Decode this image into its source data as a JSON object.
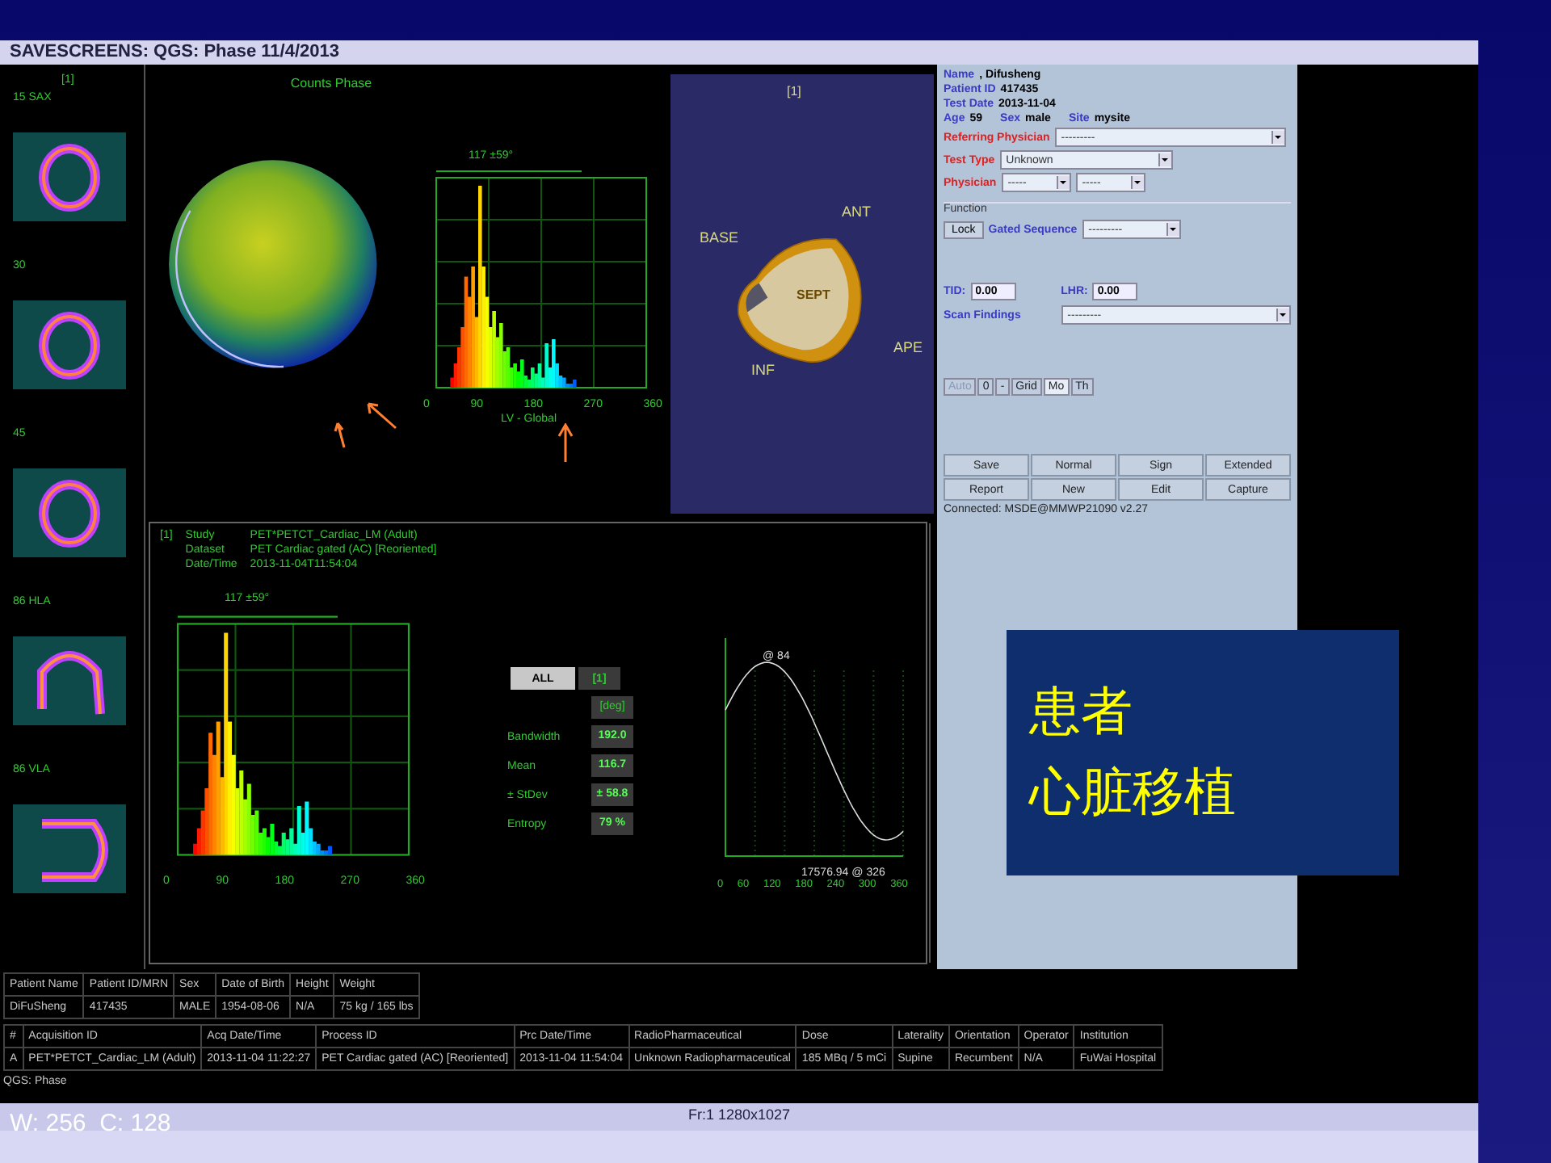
{
  "window": {
    "title": "SAVESCREENS: QGS: Phase 11/4/2013"
  },
  "slices": [
    {
      "label": "15 SAX",
      "kind": "sax"
    },
    {
      "label": "30",
      "kind": "sax"
    },
    {
      "label": "45",
      "kind": "sax"
    },
    {
      "label": "86 HLA",
      "kind": "hla"
    },
    {
      "label": "86 VLA",
      "kind": "vla"
    }
  ],
  "slices_index": "[1]",
  "polar_map": {
    "title": "Counts Phase"
  },
  "phase_histogram": {
    "range_label": "117 ±59°",
    "xticks": [
      "0",
      "90",
      "180",
      "270",
      "360"
    ],
    "xlabel": "LV - Global"
  },
  "model_3d": {
    "index": "[1]",
    "labels": [
      {
        "text": "BASE",
        "kind": "base"
      },
      {
        "text": "ANT",
        "kind": "ant"
      },
      {
        "text": "SEPT",
        "kind": "sept"
      },
      {
        "text": "INF",
        "kind": "inf"
      },
      {
        "text": "APE",
        "kind": "ape"
      }
    ]
  },
  "patient_panel": {
    "info": [
      {
        "label": "Name",
        "value": ", Difusheng"
      },
      {
        "label": "Patient ID",
        "value": "417435"
      },
      {
        "label": "Test Date",
        "value": "2013-11-04"
      }
    ],
    "info_row": [
      {
        "label": "Age",
        "value": "59"
      },
      {
        "label": "Sex",
        "value": "male"
      },
      {
        "label": "Site",
        "value": "mysite"
      }
    ],
    "referring_physician": {
      "label": "Referring Physician",
      "value": "---------"
    },
    "test_type": {
      "label": "Test Type",
      "value": "Unknown"
    },
    "physician": {
      "label": "Physician",
      "values": [
        "-----",
        "-----"
      ]
    },
    "function": {
      "legend": "Function",
      "lock": "Lock",
      "gated_label": "Gated Sequence",
      "gated_value": "---------"
    },
    "tid": {
      "label": "TID:",
      "value": "0.00"
    },
    "lhr": {
      "label": "LHR:",
      "value": "0.00"
    },
    "scan_findings": {
      "label": "Scan Findings",
      "value": "---------"
    },
    "toolbar": [
      {
        "label": "Auto",
        "selected": false,
        "disabled": true
      },
      {
        "label": "0",
        "selected": false,
        "disabled": false
      },
      {
        "label": "-",
        "selected": false,
        "disabled": false
      },
      {
        "label": "Grid",
        "selected": false,
        "disabled": false
      },
      {
        "label": "Mo",
        "selected": true,
        "disabled": false
      },
      {
        "label": "Th",
        "selected": false,
        "disabled": false
      }
    ],
    "buttons": [
      "Save",
      "Normal",
      "Sign",
      "Extended",
      "Report",
      "New",
      "Edit",
      "Capture"
    ],
    "status": "Connected: MSDE@MMWP21090 v2.27"
  },
  "analysis": {
    "index": "[1]",
    "info": [
      {
        "label": "Study",
        "value": "PET*PETCT_Cardiac_LM (Adult)"
      },
      {
        "label": "Dataset",
        "value": "PET Cardiac gated (AC) [Reoriented]"
      },
      {
        "label": "Date/Time",
        "value": "2013-11-04T11:54:04"
      }
    ],
    "histogram": {
      "range_label": "117 ±59°",
      "xticks": [
        "0",
        "90",
        "180",
        "270",
        "360"
      ]
    },
    "tabs": [
      {
        "label": "ALL",
        "selected": true
      },
      {
        "label": "[1]",
        "selected": false
      }
    ],
    "unit": "[deg]",
    "stats": [
      {
        "label": "Bandwidth",
        "value": "192.0"
      },
      {
        "label": "Mean",
        "value": "116.7"
      },
      {
        "label": "± StDev",
        "value": "± 58.8"
      },
      {
        "label": "Entropy",
        "value": "79 %"
      }
    ],
    "curve": {
      "peak_label": "@ 84",
      "min_label": "17576.94 @ 326",
      "xticks": [
        "0",
        "60",
        "120",
        "180",
        "240",
        "300",
        "360"
      ]
    }
  },
  "patient_table": {
    "columns": [
      "Patient Name",
      "Patient ID/MRN",
      "Sex",
      "Date of Birth",
      "Height",
      "Weight"
    ],
    "row": [
      "DiFuSheng",
      "417435",
      "MALE",
      "1954-08-06",
      "N/A",
      "75 kg / 165 lbs"
    ]
  },
  "acquisition_table": {
    "columns": [
      "#",
      "Acquisition ID",
      "Acq Date/Time",
      "Process ID",
      "Prc Date/Time",
      "RadioPharmaceutical",
      "Dose",
      "Laterality",
      "Orientation",
      "Operator",
      "Institution"
    ],
    "row": [
      "A",
      "PET*PETCT_Cardiac_LM (Adult)",
      "2013-11-04 11:22:27",
      "PET Cardiac gated (AC) [Reoriented]",
      "2013-11-04 11:54:04",
      "Unknown Radiopharmaceutical",
      "185 MBq / 5 mCi",
      "Supine",
      "Recumbent",
      "N/A",
      "FuWai Hospital"
    ]
  },
  "status_bar": "QGS: Phase",
  "footer": {
    "window_level": "W: 256  C: 128",
    "frame": "Fr:1 1280x1027"
  },
  "note": {
    "lines": [
      "患者",
      "心脏移植"
    ]
  }
}
